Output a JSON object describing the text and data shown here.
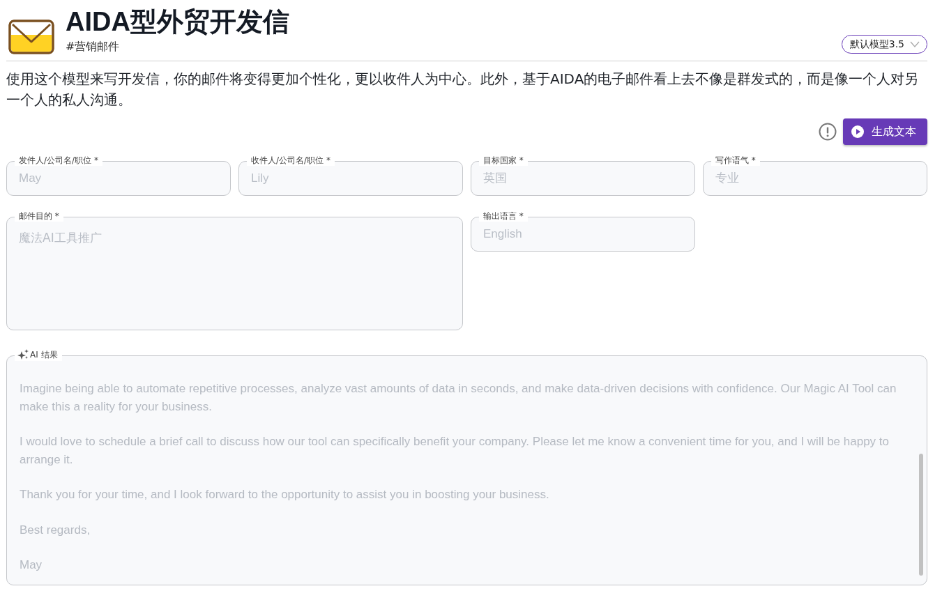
{
  "header": {
    "title": "AIDA型外贸开发信",
    "tag": "#营销邮件",
    "model_button": "默认模型3.5"
  },
  "description": "使用这个模型来写开发信，你的邮件将变得更加个性化，更以收件人为中心。此外，基于AIDA的电子邮件看上去不像是群发式的，而是像一个人对另一个人的私人沟通。",
  "generate_button": "生成文本",
  "fields": [
    {
      "label": "发件人/公司名/职位 *",
      "placeholder": "May",
      "kind": "input"
    },
    {
      "label": "收件人/公司名/职位 *",
      "placeholder": "Lily",
      "kind": "input"
    },
    {
      "label": "目标国家 *",
      "placeholder": "英国",
      "kind": "input"
    },
    {
      "label": "写作语气 *",
      "placeholder": "专业",
      "kind": "input"
    },
    {
      "label": "邮件目的 *",
      "placeholder": "魔法AI工具推广",
      "kind": "textarea"
    },
    {
      "label": "输出语言 *",
      "placeholder": "English",
      "kind": "input"
    }
  ],
  "result": {
    "label": "AI 结果",
    "paragraphs": [
      "Imagine being able to automate repetitive processes, analyze vast amounts of data in seconds, and make data-driven decisions with confidence. Our Magic AI Tool can make this a reality for your business.",
      "I would love to schedule a brief call to discuss how our tool can specifically benefit your company. Please let me know a convenient time for you, and I will be happy to arrange it.",
      "Thank you for your time, and I look forward to the opportunity to assist you in boosting your business.",
      "Best regards,",
      "May"
    ]
  }
}
